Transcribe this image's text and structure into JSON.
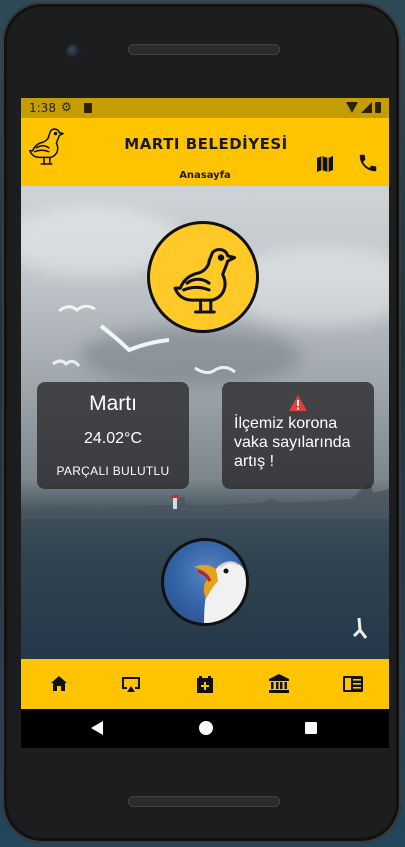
{
  "status_bar": {
    "time": "1:38",
    "icons": [
      "gear-icon",
      "sd-card-icon",
      "wifi-icon",
      "signal-icon",
      "battery-icon"
    ]
  },
  "app_bar": {
    "title": "MARTI BELEDİYESİ",
    "subtitle": "Anasayfa",
    "logo": "seagull-logo",
    "actions": [
      "map-icon",
      "phone-icon"
    ]
  },
  "weather": {
    "city": "Martı",
    "temperature": "24.02°C",
    "description": "PARÇALI BULUTLU"
  },
  "news": {
    "icon": "warning-icon",
    "text": "İlçemiz korona vaka sayılarında artış !"
  },
  "bottom_nav": {
    "items": [
      "home-icon",
      "cast-icon",
      "add-box-icon",
      "account-balance-icon",
      "article-icon"
    ]
  },
  "colors": {
    "accent": "#ffc400",
    "card_bg": "rgba(40,40,42,0.78)"
  }
}
